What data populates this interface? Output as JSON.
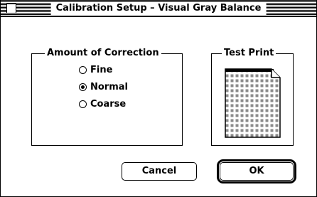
{
  "dialog": {
    "title": "Calibration Setup – Visual Gray Balance"
  },
  "amount_group": {
    "legend": "Amount of Correction",
    "options": [
      {
        "label": "Fine",
        "checked": false
      },
      {
        "label": "Normal",
        "checked": true
      },
      {
        "label": "Coarse",
        "checked": false
      }
    ]
  },
  "test_print_group": {
    "legend": "Test Print",
    "icon": "test-print-page-icon"
  },
  "buttons": {
    "cancel_label": "Cancel",
    "ok_label": "OK"
  }
}
